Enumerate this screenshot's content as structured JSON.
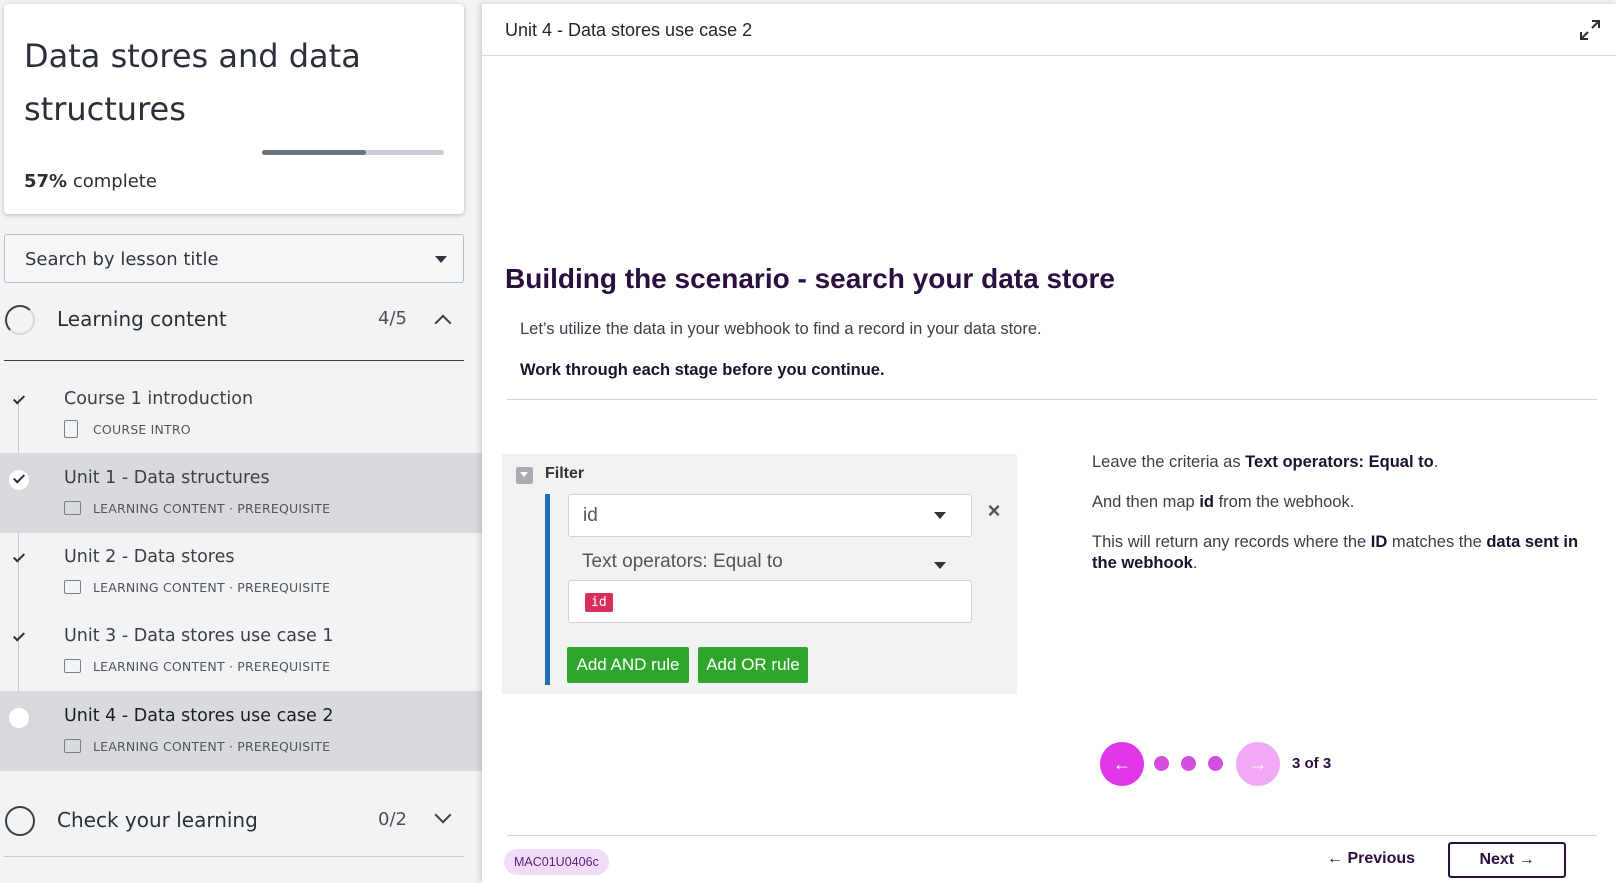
{
  "course": {
    "title": "Data stores and data structures",
    "progress_value": "57%",
    "progress_suffix": "complete",
    "progress_fraction": 0.57
  },
  "search": {
    "label": "Search by lesson title"
  },
  "sections": [
    {
      "title": "Learning content",
      "count": "4/5",
      "expanded": true
    },
    {
      "title": "Check your learning",
      "count": "0/2",
      "expanded": false
    }
  ],
  "lessons": [
    {
      "title": "Course 1 introduction",
      "meta": "COURSE INTRO",
      "completed": true,
      "current": false
    },
    {
      "title": "Unit 1 - Data structures",
      "meta": "LEARNING CONTENT · PREREQUISITE",
      "completed": true,
      "current": false
    },
    {
      "title": "Unit 2 - Data stores",
      "meta": "LEARNING CONTENT · PREREQUISITE",
      "completed": true,
      "current": false
    },
    {
      "title": "Unit 3 - Data stores use case 1",
      "meta": "LEARNING CONTENT · PREREQUISITE",
      "completed": true,
      "current": false
    },
    {
      "title": "Unit 4 - Data stores use case 2",
      "meta": "LEARNING CONTENT · PREREQUISITE",
      "completed": false,
      "current": true
    }
  ],
  "panel": {
    "title": "Unit 4 - Data stores use case 2"
  },
  "slide": {
    "title": "Building the scenario - search your data store",
    "subtitle": "Let’s utilize the data in your webhook to find a record in your data store.",
    "instruction": "Work through each stage before you continue."
  },
  "filter": {
    "label": "Filter",
    "field_value": "id",
    "operator": "Text operators: Equal to",
    "value_chip": "id",
    "add_and": "Add AND rule",
    "add_or": "Add OR rule"
  },
  "notes": {
    "p1_pre": "Leave the criteria as ",
    "p1_bold": "Text operators: Equal to",
    "p1_post": ".",
    "p2_pre": "And then map ",
    "p2_bold": "id",
    "p2_post": " from the webhook.",
    "p3_pre": "This will return any records where the ",
    "p3_bold1": "ID",
    "p3_mid": " matches the ",
    "p3_bold2": "data sent in the webhook",
    "p3_post": "."
  },
  "pager": {
    "text": "3 of 3",
    "current": 3,
    "total": 3
  },
  "footer": {
    "code": "MAC01U0406c",
    "previous": "← Previous",
    "next": "Next →"
  },
  "colors": {
    "accent_pink": "#e037e8",
    "filter_green": "#2fa52b",
    "filter_blue": "#1f6fb4",
    "chip_red": "#d6305a",
    "heading_purple": "#2b0f3f"
  }
}
